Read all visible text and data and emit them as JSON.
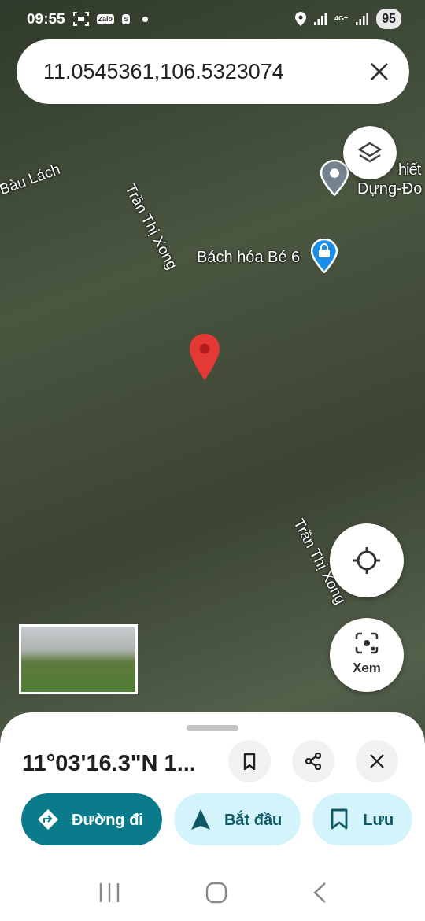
{
  "status_bar": {
    "time": "09:55",
    "app_icons": [
      "Zalo",
      "S"
    ],
    "network": "4G+",
    "battery": "95"
  },
  "search": {
    "value": "11.0545361,106.5323074"
  },
  "map_labels": [
    {
      "kind": "street",
      "text": "Bàu Lách"
    },
    {
      "kind": "street",
      "text": "Trần Thị Xong"
    },
    {
      "kind": "place",
      "text": "hiết"
    },
    {
      "kind": "place",
      "text": "Dựng-Đo"
    },
    {
      "kind": "place",
      "text": "Bách hóa Bé 6"
    },
    {
      "kind": "street",
      "text": "Trần Thị Xong"
    }
  ],
  "map_controls": {
    "view_label": "Xem"
  },
  "place_sheet": {
    "title": "11°03'16.3\"N 1...",
    "actions": [
      {
        "kind": "directions",
        "label": "Đường đi",
        "primary": true
      },
      {
        "kind": "start",
        "label": "Bắt đầu",
        "primary": false
      },
      {
        "kind": "save",
        "label": "Lưu",
        "primary": false
      }
    ]
  }
}
